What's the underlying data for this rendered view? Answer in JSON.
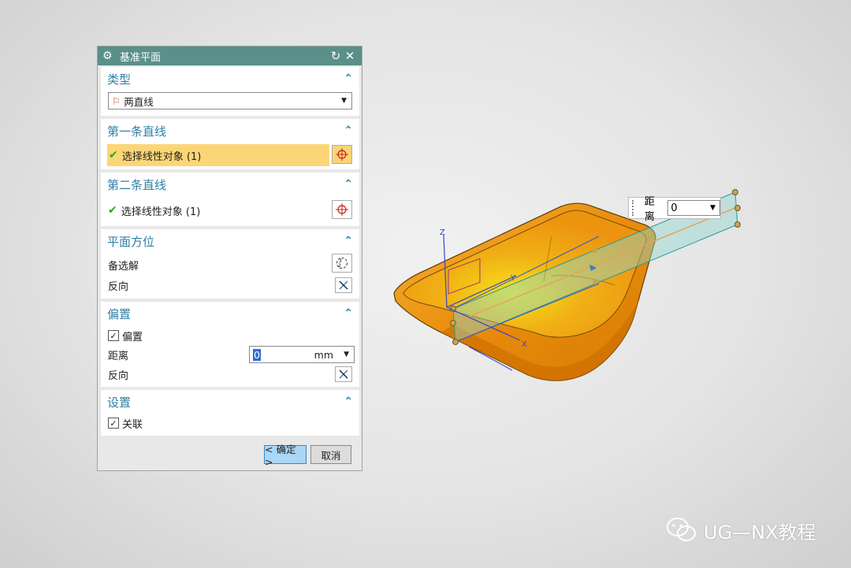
{
  "dialog": {
    "title": "基准平面",
    "type_section": {
      "label": "类型",
      "selected": "两直线"
    },
    "first_line": {
      "label": "第一条直线",
      "selection": "选择线性对象 (1)"
    },
    "second_line": {
      "label": "第二条直线",
      "selection": "选择线性对象 (1)"
    },
    "orientation": {
      "label": "平面方位",
      "alternate": "备选解",
      "reverse": "反向"
    },
    "offset": {
      "label": "偏置",
      "checkbox": "偏置",
      "distance_label": "距离",
      "distance_value": "0",
      "unit": "mm",
      "reverse": "反向"
    },
    "settings": {
      "label": "设置",
      "associative": "关联"
    },
    "buttons": {
      "ok": "< 确定 >",
      "cancel": "取消"
    }
  },
  "viewport": {
    "distance_popup": {
      "label": "距离",
      "value": "0"
    },
    "axis_z": "Z",
    "axis_y": "Y",
    "axis_x": "X"
  },
  "watermark": {
    "text": "UG—NX教程"
  },
  "colors": {
    "title_bar": "#5a8f8a",
    "section_header": "#2f7fa5",
    "highlight_row": "#fcd676",
    "part": "#f29a12",
    "plane": "#8fd6d0"
  }
}
